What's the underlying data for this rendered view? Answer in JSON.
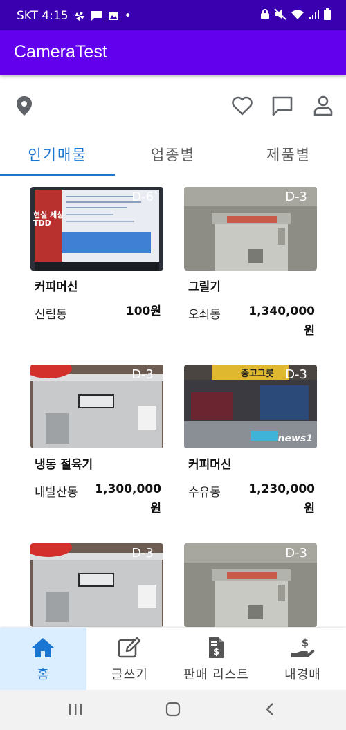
{
  "status_bar": {
    "carrier_time": "SKT 4:15",
    "dot": "•"
  },
  "app": {
    "title": "CameraTest"
  },
  "tabs": [
    {
      "label": "인기매물"
    },
    {
      "label": "업종별"
    },
    {
      "label": "제품별"
    }
  ],
  "products": [
    {
      "dday": "D-6",
      "title": "커피머신",
      "location": "신림동",
      "price": "100원",
      "image": "monitor-tdd-photo"
    },
    {
      "dday": "D-3",
      "title": "그릴기",
      "location": "오쇠동",
      "price": "1,340,000원",
      "image": "steel-machine-photo"
    },
    {
      "dday": "D-3",
      "title": "냉동 절육기",
      "location": "내발산동",
      "price": "1,300,000원",
      "image": "steel-fridge-photo"
    },
    {
      "dday": "D-3",
      "title": "커피머신",
      "location": "수유동",
      "price": "1,230,000원",
      "image": "used-market-photo"
    },
    {
      "dday": "D-3",
      "title": "",
      "location": "",
      "price": "",
      "image": "steel-fridge-photo"
    },
    {
      "dday": "D-3",
      "title": "",
      "location": "",
      "price": "",
      "image": "steel-machine-photo"
    }
  ],
  "thumb_text": {
    "monitor_line1": "현실 세상",
    "monitor_line2": "TDD",
    "market_sign": "중고그릇",
    "news_logo": "news1"
  },
  "bottom_nav": [
    {
      "label": "홈",
      "icon": "home-icon"
    },
    {
      "label": "글쓰기",
      "icon": "edit-icon"
    },
    {
      "label": "판매 리스트",
      "icon": "invoice-icon"
    },
    {
      "label": "내경매",
      "icon": "hand-dollar-icon"
    }
  ],
  "colors": {
    "app_bar": "#6200ee",
    "status_bar": "#3a00b0",
    "accent": "#1976d2",
    "nav_active_bg": "#dbeeff"
  }
}
